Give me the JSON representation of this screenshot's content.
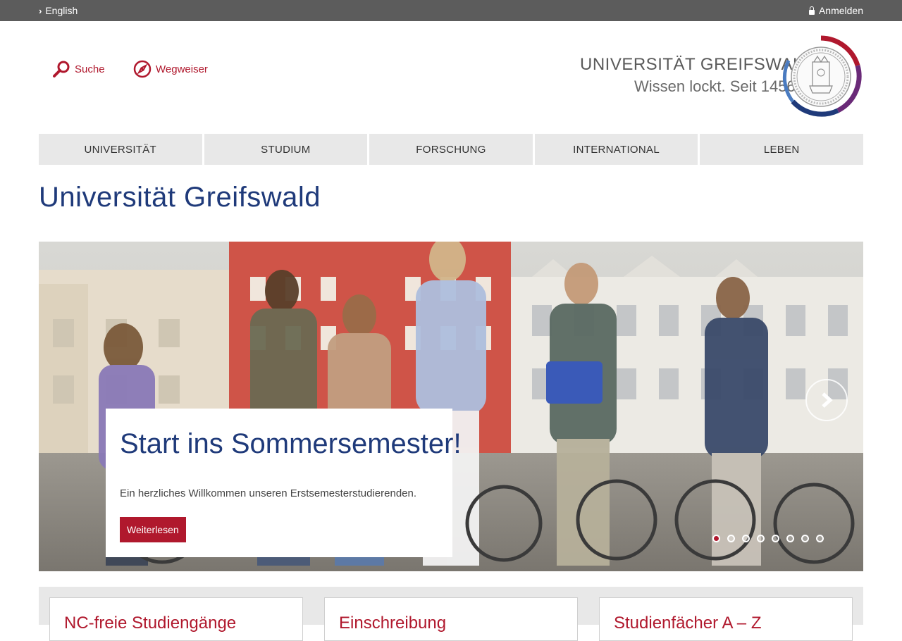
{
  "topbar": {
    "language_link": "English",
    "login_link": "Anmelden"
  },
  "tools": {
    "search_label": "Suche",
    "guide_label": "Wegweiser"
  },
  "logo": {
    "name": "UNIVERSITÄT GREIFSWALD",
    "tagline": "Wissen lockt. Seit 1456"
  },
  "nav": {
    "items": [
      "UNIVERSITÄT",
      "STUDIUM",
      "FORSCHUNG",
      "INTERNATIONAL",
      "LEBEN"
    ]
  },
  "page": {
    "title": "Universität Greifswald"
  },
  "slider": {
    "heading": "Start ins Sommersemester!",
    "text": "Ein herzliches Willkommen unseren Erstsemesterstudierenden.",
    "button": "Weiterlesen",
    "slide_count": 8,
    "active_slide": 1
  },
  "teasers": [
    "NC-freie Studiengänge",
    "Einschreibung",
    "Studienfächer A – Z"
  ],
  "colors": {
    "brand_red": "#b0182d",
    "brand_blue": "#1f3a7a",
    "topbar": "#5c5c5c",
    "nav_bg": "#e8e8e8"
  }
}
